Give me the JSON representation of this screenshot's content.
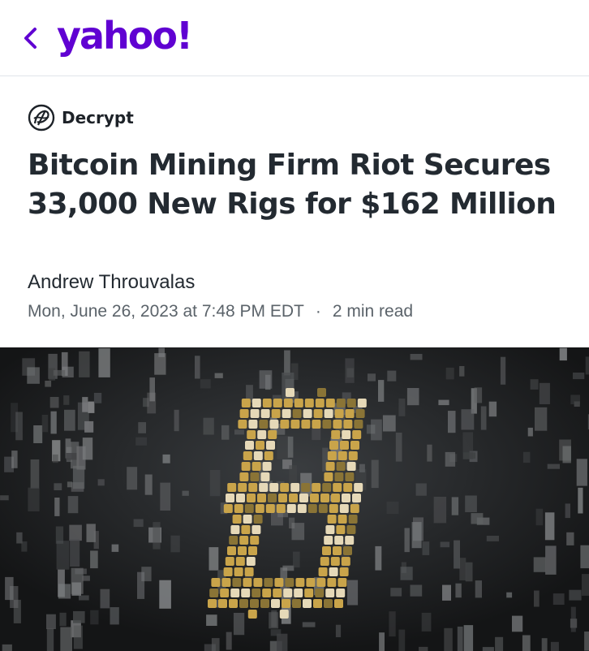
{
  "header": {
    "logo_text": "yahoo!",
    "logo_color": "#6001d2",
    "back_icon": "chevron-left-icon"
  },
  "article": {
    "publisher": "Decrypt",
    "publisher_icon": "decrypt-logo-icon",
    "headline": "Bitcoin Mining Firm Riot Secures 33,000 New Rigs for $162 Million",
    "author": "Andrew Throuvalas",
    "date": "Mon, June 26, 2023 at 7:48 PM EDT",
    "separator": "·",
    "read_time": "2 min read"
  },
  "hero_image": {
    "subject": "bitcoin-symbol-image"
  },
  "colors": {
    "text_primary": "#232a31",
    "text_secondary": "#5b636a",
    "gold": "#c9a44a",
    "dark_bg": "#1b1d1f"
  }
}
